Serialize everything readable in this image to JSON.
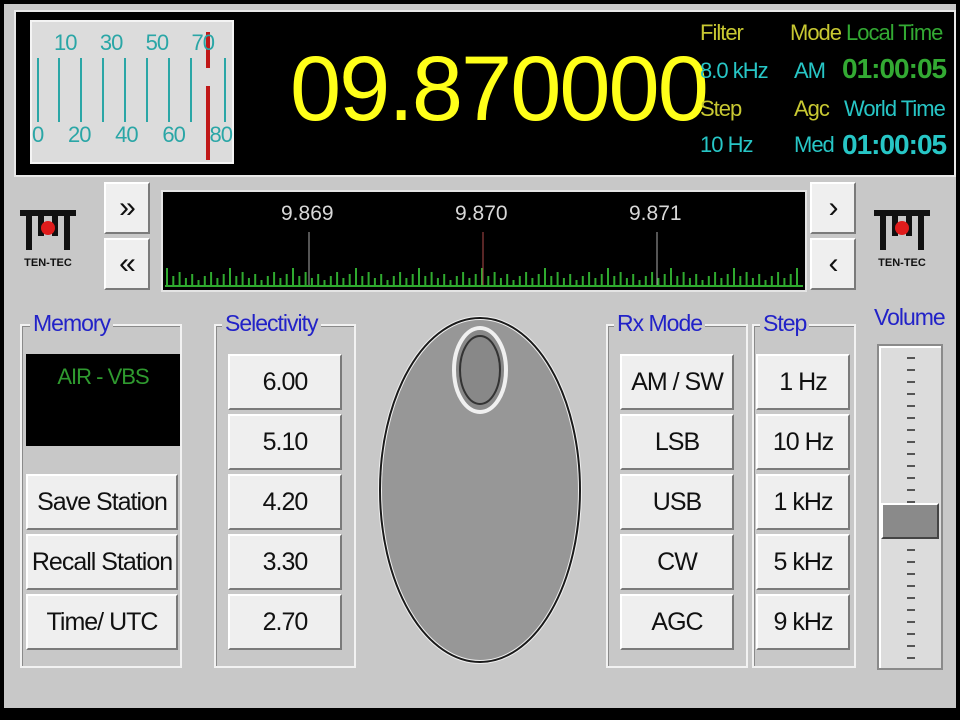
{
  "smeter": {
    "top_scale": [
      "10",
      "30",
      "50",
      "70"
    ],
    "bottom_scale": [
      "0",
      "20",
      "40",
      "60",
      "80"
    ]
  },
  "frequency": "09.870000",
  "filter": {
    "label": "Filter",
    "value": "8.0 kHz"
  },
  "step_info": {
    "label": "Step",
    "value": "10 Hz"
  },
  "mode_info": {
    "label": "Mode",
    "value": "AM"
  },
  "agc_info": {
    "label": "Agc",
    "value": "Med"
  },
  "local_time": {
    "label": "Local Time",
    "value": "01:00:05"
  },
  "world_time": {
    "label": "World Time",
    "value": "01:00:05"
  },
  "nav": {
    "fast_fwd": "»",
    "fast_back": "«",
    "fwd": "›",
    "back": "‹"
  },
  "tuning_scale": [
    "9.869",
    "9.870",
    "9.871"
  ],
  "logo_text": "TEN-TEC",
  "memory": {
    "title": "Memory",
    "display": "AIR - VBS",
    "buttons": [
      "Save Station",
      "Recall Station",
      "Time/ UTC"
    ]
  },
  "selectivity": {
    "title": "Selectivity",
    "buttons": [
      "6.00",
      "5.10",
      "4.20",
      "3.30",
      "2.70"
    ]
  },
  "rx_mode": {
    "title": "Rx Mode",
    "buttons": [
      "AM / SW",
      "LSB",
      "USB",
      "CW",
      "AGC"
    ]
  },
  "step": {
    "title": "Step",
    "buttons": [
      "1 Hz",
      "10 Hz",
      "1 kHz",
      "5 kHz",
      "9 kHz"
    ]
  },
  "volume": {
    "title": "Volume",
    "level": 0.45
  },
  "colors": {
    "frequency": "#ffff19",
    "label_yellow": "#c8c832",
    "value_cyan": "#27c6c6",
    "time_green": "#33aa33",
    "group_title": "#2222c8",
    "panel": "#c8c8c8"
  }
}
